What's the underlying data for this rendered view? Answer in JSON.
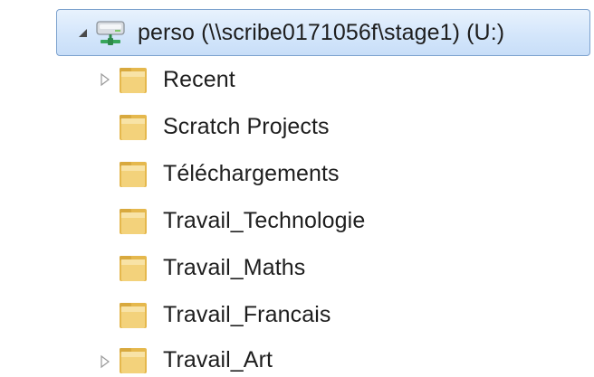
{
  "tree": {
    "drive": {
      "label": "perso (\\\\scribe0171056f\\stage1) (U:)",
      "icon": "network-drive-icon",
      "expanded": true
    },
    "folders": [
      {
        "label": "Recent",
        "has_children": true,
        "icon": "folder-icon"
      },
      {
        "label": "Scratch Projects",
        "has_children": false,
        "icon": "folder-icon"
      },
      {
        "label": "Téléchargements",
        "has_children": false,
        "icon": "folder-icon"
      },
      {
        "label": "Travail_Technologie",
        "has_children": false,
        "icon": "folder-icon"
      },
      {
        "label": "Travail_Maths",
        "has_children": false,
        "icon": "folder-icon"
      },
      {
        "label": "Travail_Francais",
        "has_children": false,
        "icon": "folder-icon"
      },
      {
        "label": "Travail_Art",
        "has_children": true,
        "icon": "folder-icon"
      }
    ]
  },
  "colors": {
    "selection_border": "#7da2ce",
    "selection_fill": "#d4e6fb",
    "folder_yellow": "#f1cd6a",
    "text": "#1e1e1e"
  }
}
